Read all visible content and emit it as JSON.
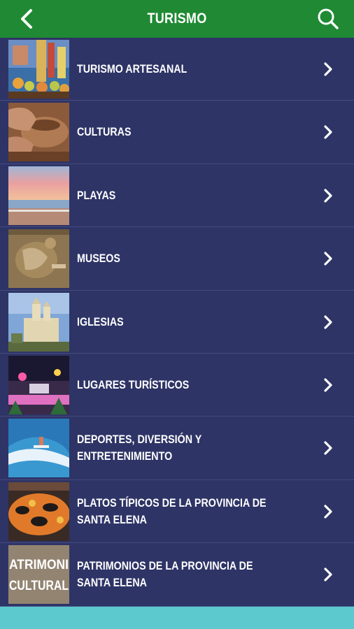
{
  "header": {
    "title": "TURISMO",
    "back_icon": "chevron-left-icon",
    "search_icon": "search-icon",
    "color": "#1f8a33"
  },
  "list": {
    "items": [
      {
        "label": "TURISMO ARTESANAL",
        "thumb": "handicraft-photo"
      },
      {
        "label": "CULTURAS",
        "thumb": "pottery-photo"
      },
      {
        "label": "PLAYAS",
        "thumb": "beach-sunset-photo"
      },
      {
        "label": "MUSEOS",
        "thumb": "archaeology-photo"
      },
      {
        "label": "IGLESIAS",
        "thumb": "church-photo"
      },
      {
        "label": "LUGARES TURÍSTICOS",
        "thumb": "night-plaza-photo"
      },
      {
        "label": "DEPORTES, DIVERSIÓN Y ENTRETENIMIENTO",
        "thumb": "surfing-photo"
      },
      {
        "label": "PLATOS TÍPICOS DE LA PROVINCIA DE\nSANTA ELENA",
        "thumb": "seafood-dish-photo"
      },
      {
        "label": "PATRIMONIOS DE LA PROVINCIA DE\nSANTA ELENA",
        "thumb": "patrimonio-cultural-photo",
        "thumb_text": [
          "ATRIMONI",
          "CULTURAL"
        ]
      }
    ],
    "chevron_icon": "chevron-right-icon",
    "background": "#2e3466"
  },
  "footer": {
    "color": "#5cc9cf"
  }
}
